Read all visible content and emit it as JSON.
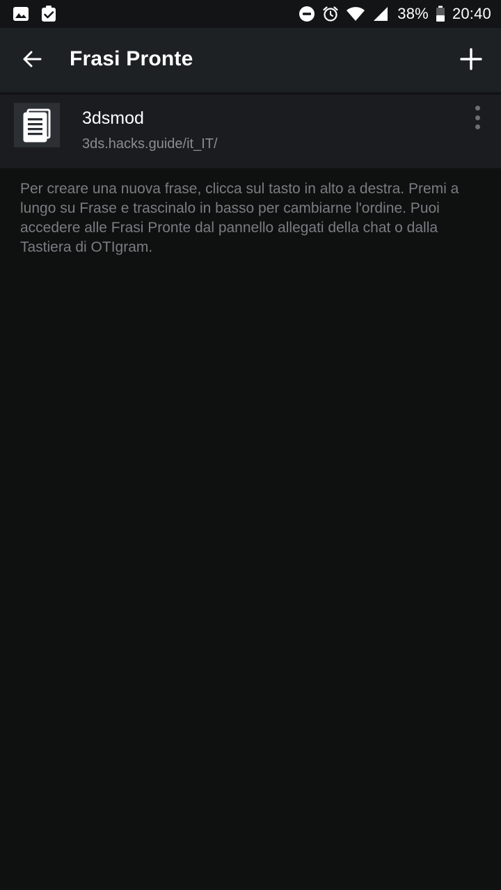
{
  "status_bar": {
    "battery_percent": "38%",
    "time": "20:40",
    "left_icons": [
      "image-icon",
      "clipboard-check-icon"
    ],
    "right_icons": [
      "do-not-disturb-icon",
      "alarm-icon",
      "wifi-icon",
      "cell-signal-icon",
      "battery-icon"
    ]
  },
  "app_bar": {
    "title": "Frasi Pronte",
    "back_icon": "arrow-left-icon",
    "add_icon": "plus-icon"
  },
  "list": {
    "items": [
      {
        "title": "3dsmod",
        "subtitle": "3ds.hacks.guide/it_IT/",
        "icon": "document-icon",
        "menu_icon": "more-vertical-icon"
      }
    ]
  },
  "info": {
    "text": "Per creare una nuova frase, clicca sul tasto in alto a destra. Premi a lungo su Frase e trascinalo in basso per cambiarne l'ordine. Puoi accedere alle Frasi Pronte dal pannello allegati della chat o dalla Tastiera di OTIgram."
  },
  "colors": {
    "background": "#0f1010",
    "app_bar": "#1e2124",
    "list_item_bg": "#1a1c1f",
    "primary_text": "#ffffff",
    "secondary_text": "#8a8d91",
    "hint_text": "#7a7d81"
  }
}
